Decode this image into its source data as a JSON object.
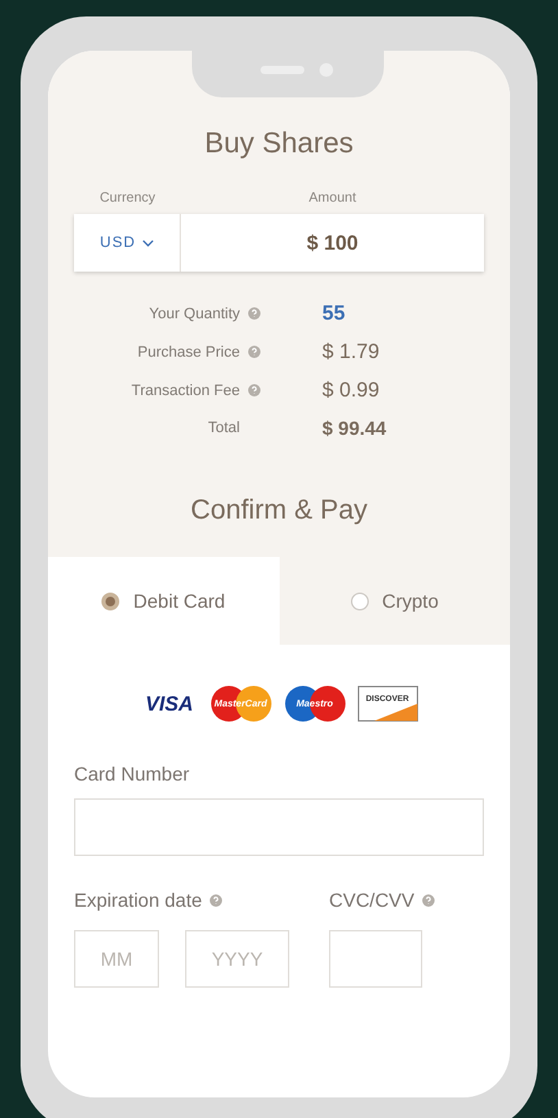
{
  "header": {
    "title": "Buy Shares"
  },
  "currency": {
    "label": "Currency",
    "value": "USD"
  },
  "amount": {
    "label": "Amount",
    "value": "$ 100"
  },
  "summary": [
    {
      "label": "Your Quantity",
      "value": "55",
      "help": true,
      "kind": "highlight"
    },
    {
      "label": "Purchase Price",
      "value": "$ 1.79",
      "help": true,
      "kind": "plain"
    },
    {
      "label": "Transaction Fee",
      "value": "$ 0.99",
      "help": true,
      "kind": "plain"
    },
    {
      "label": "Total",
      "value": "$ 99.44",
      "help": false,
      "kind": "total"
    }
  ],
  "section_title": "Confirm & Pay",
  "payment_tabs": [
    {
      "label": "Debit Card",
      "selected": true
    },
    {
      "label": "Crypto",
      "selected": false
    }
  ],
  "card_logos": [
    {
      "kind": "visa",
      "text": "VISA"
    },
    {
      "kind": "mastercard",
      "text": "MasterCard"
    },
    {
      "kind": "maestro",
      "text": "Maestro"
    },
    {
      "kind": "discover",
      "text": "DISCOVER"
    }
  ],
  "form": {
    "card_number": {
      "label": "Card Number"
    },
    "expiration": {
      "label": "Expiration date",
      "help": true,
      "month_placeholder": "MM",
      "year_placeholder": "YYYY"
    },
    "cvc": {
      "label": "CVC/CVV",
      "help": true
    }
  }
}
